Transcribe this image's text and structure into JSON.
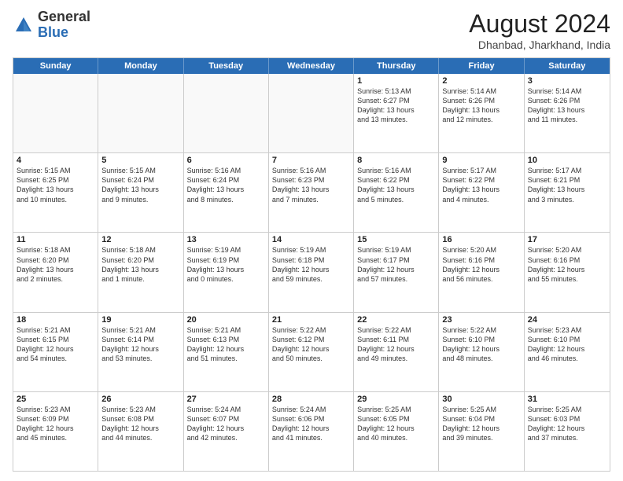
{
  "logo": {
    "general": "General",
    "blue": "Blue"
  },
  "header": {
    "title": "August 2024",
    "subtitle": "Dhanbad, Jharkhand, India"
  },
  "days": [
    "Sunday",
    "Monday",
    "Tuesday",
    "Wednesday",
    "Thursday",
    "Friday",
    "Saturday"
  ],
  "rows": [
    [
      {
        "day": "",
        "empty": true
      },
      {
        "day": "",
        "empty": true
      },
      {
        "day": "",
        "empty": true
      },
      {
        "day": "",
        "empty": true
      },
      {
        "day": "1",
        "lines": [
          "Sunrise: 5:13 AM",
          "Sunset: 6:27 PM",
          "Daylight: 13 hours",
          "and 13 minutes."
        ]
      },
      {
        "day": "2",
        "lines": [
          "Sunrise: 5:14 AM",
          "Sunset: 6:26 PM",
          "Daylight: 13 hours",
          "and 12 minutes."
        ]
      },
      {
        "day": "3",
        "lines": [
          "Sunrise: 5:14 AM",
          "Sunset: 6:26 PM",
          "Daylight: 13 hours",
          "and 11 minutes."
        ]
      }
    ],
    [
      {
        "day": "4",
        "lines": [
          "Sunrise: 5:15 AM",
          "Sunset: 6:25 PM",
          "Daylight: 13 hours",
          "and 10 minutes."
        ]
      },
      {
        "day": "5",
        "lines": [
          "Sunrise: 5:15 AM",
          "Sunset: 6:24 PM",
          "Daylight: 13 hours",
          "and 9 minutes."
        ]
      },
      {
        "day": "6",
        "lines": [
          "Sunrise: 5:16 AM",
          "Sunset: 6:24 PM",
          "Daylight: 13 hours",
          "and 8 minutes."
        ]
      },
      {
        "day": "7",
        "lines": [
          "Sunrise: 5:16 AM",
          "Sunset: 6:23 PM",
          "Daylight: 13 hours",
          "and 7 minutes."
        ]
      },
      {
        "day": "8",
        "lines": [
          "Sunrise: 5:16 AM",
          "Sunset: 6:22 PM",
          "Daylight: 13 hours",
          "and 5 minutes."
        ]
      },
      {
        "day": "9",
        "lines": [
          "Sunrise: 5:17 AM",
          "Sunset: 6:22 PM",
          "Daylight: 13 hours",
          "and 4 minutes."
        ]
      },
      {
        "day": "10",
        "lines": [
          "Sunrise: 5:17 AM",
          "Sunset: 6:21 PM",
          "Daylight: 13 hours",
          "and 3 minutes."
        ]
      }
    ],
    [
      {
        "day": "11",
        "lines": [
          "Sunrise: 5:18 AM",
          "Sunset: 6:20 PM",
          "Daylight: 13 hours",
          "and 2 minutes."
        ]
      },
      {
        "day": "12",
        "lines": [
          "Sunrise: 5:18 AM",
          "Sunset: 6:20 PM",
          "Daylight: 13 hours",
          "and 1 minute."
        ]
      },
      {
        "day": "13",
        "lines": [
          "Sunrise: 5:19 AM",
          "Sunset: 6:19 PM",
          "Daylight: 13 hours",
          "and 0 minutes."
        ]
      },
      {
        "day": "14",
        "lines": [
          "Sunrise: 5:19 AM",
          "Sunset: 6:18 PM",
          "Daylight: 12 hours",
          "and 59 minutes."
        ]
      },
      {
        "day": "15",
        "lines": [
          "Sunrise: 5:19 AM",
          "Sunset: 6:17 PM",
          "Daylight: 12 hours",
          "and 57 minutes."
        ]
      },
      {
        "day": "16",
        "lines": [
          "Sunrise: 5:20 AM",
          "Sunset: 6:16 PM",
          "Daylight: 12 hours",
          "and 56 minutes."
        ]
      },
      {
        "day": "17",
        "lines": [
          "Sunrise: 5:20 AM",
          "Sunset: 6:16 PM",
          "Daylight: 12 hours",
          "and 55 minutes."
        ]
      }
    ],
    [
      {
        "day": "18",
        "lines": [
          "Sunrise: 5:21 AM",
          "Sunset: 6:15 PM",
          "Daylight: 12 hours",
          "and 54 minutes."
        ]
      },
      {
        "day": "19",
        "lines": [
          "Sunrise: 5:21 AM",
          "Sunset: 6:14 PM",
          "Daylight: 12 hours",
          "and 53 minutes."
        ]
      },
      {
        "day": "20",
        "lines": [
          "Sunrise: 5:21 AM",
          "Sunset: 6:13 PM",
          "Daylight: 12 hours",
          "and 51 minutes."
        ]
      },
      {
        "day": "21",
        "lines": [
          "Sunrise: 5:22 AM",
          "Sunset: 6:12 PM",
          "Daylight: 12 hours",
          "and 50 minutes."
        ]
      },
      {
        "day": "22",
        "lines": [
          "Sunrise: 5:22 AM",
          "Sunset: 6:11 PM",
          "Daylight: 12 hours",
          "and 49 minutes."
        ]
      },
      {
        "day": "23",
        "lines": [
          "Sunrise: 5:22 AM",
          "Sunset: 6:10 PM",
          "Daylight: 12 hours",
          "and 48 minutes."
        ]
      },
      {
        "day": "24",
        "lines": [
          "Sunrise: 5:23 AM",
          "Sunset: 6:10 PM",
          "Daylight: 12 hours",
          "and 46 minutes."
        ]
      }
    ],
    [
      {
        "day": "25",
        "lines": [
          "Sunrise: 5:23 AM",
          "Sunset: 6:09 PM",
          "Daylight: 12 hours",
          "and 45 minutes."
        ]
      },
      {
        "day": "26",
        "lines": [
          "Sunrise: 5:23 AM",
          "Sunset: 6:08 PM",
          "Daylight: 12 hours",
          "and 44 minutes."
        ]
      },
      {
        "day": "27",
        "lines": [
          "Sunrise: 5:24 AM",
          "Sunset: 6:07 PM",
          "Daylight: 12 hours",
          "and 42 minutes."
        ]
      },
      {
        "day": "28",
        "lines": [
          "Sunrise: 5:24 AM",
          "Sunset: 6:06 PM",
          "Daylight: 12 hours",
          "and 41 minutes."
        ]
      },
      {
        "day": "29",
        "lines": [
          "Sunrise: 5:25 AM",
          "Sunset: 6:05 PM",
          "Daylight: 12 hours",
          "and 40 minutes."
        ]
      },
      {
        "day": "30",
        "lines": [
          "Sunrise: 5:25 AM",
          "Sunset: 6:04 PM",
          "Daylight: 12 hours",
          "and 39 minutes."
        ]
      },
      {
        "day": "31",
        "lines": [
          "Sunrise: 5:25 AM",
          "Sunset: 6:03 PM",
          "Daylight: 12 hours",
          "and 37 minutes."
        ]
      }
    ]
  ]
}
